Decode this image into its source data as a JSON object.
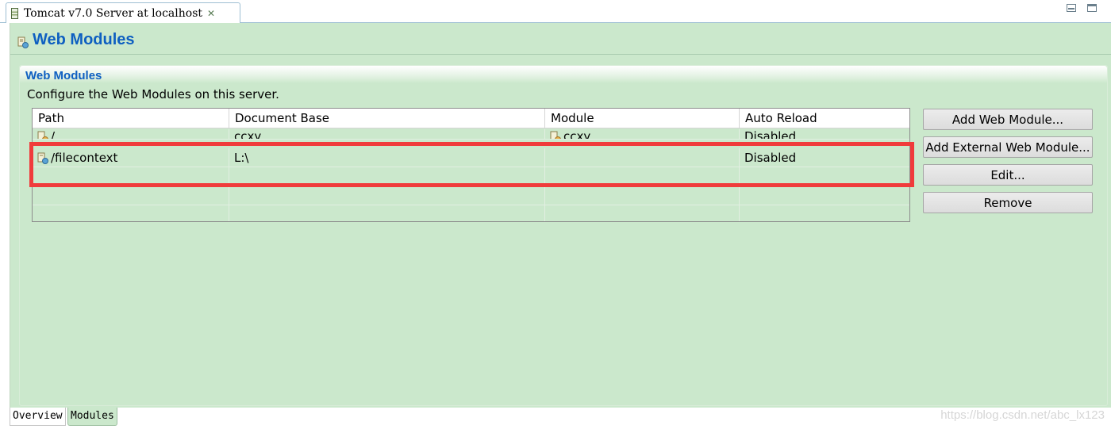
{
  "editor_tab": {
    "title": "Tomcat v7.0 Server at localhost",
    "close_icon": "✕"
  },
  "header": {
    "title": "Web Modules"
  },
  "section": {
    "title": "Web Modules",
    "description": "Configure the Web Modules on this server."
  },
  "table": {
    "columns": [
      "Path",
      "Document Base",
      "Module",
      "Auto Reload"
    ],
    "rows": [
      {
        "path": "/",
        "document_base": "ccxy",
        "module": "ccxy",
        "auto_reload": "Disabled"
      },
      {
        "path": "/filecontext",
        "document_base": "L:\\",
        "module": "",
        "auto_reload": "Disabled"
      }
    ]
  },
  "buttons": {
    "add_web_module": "Add Web Module...",
    "add_external_web_module": "Add External Web Module...",
    "edit": "Edit...",
    "remove": "Remove"
  },
  "bottom_tabs": [
    "Overview",
    "Modules"
  ],
  "watermark": "https://blog.csdn.net/abc_lx123",
  "colors": {
    "accent": "#0e5fc1",
    "editor_bg": "#cbe8cc",
    "highlight": "#f03b3b"
  }
}
